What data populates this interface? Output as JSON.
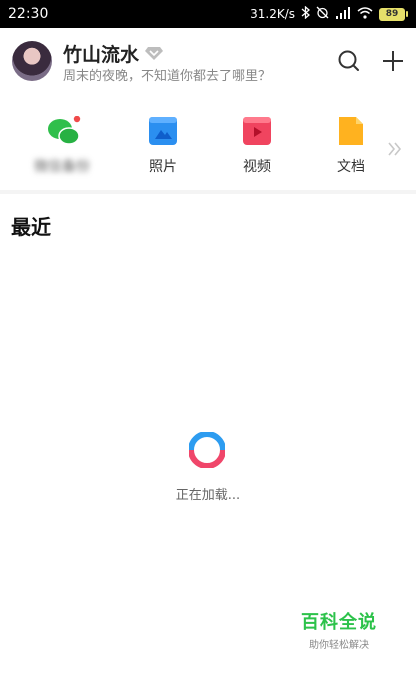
{
  "status_bar": {
    "time": "22:30",
    "network_speed": "31.2K/s",
    "battery": "89"
  },
  "header": {
    "username": "竹山流水",
    "motto": "周末的夜晚，不知道你都去了哪里？"
  },
  "shortcuts": [
    {
      "label": "微信备份",
      "icon": "wechat-icon",
      "color": "#2fbf4b"
    },
    {
      "label": "照片",
      "icon": "photo-icon",
      "color": "#2b8ff0"
    },
    {
      "label": "视频",
      "icon": "video-icon",
      "color": "#f0445f"
    },
    {
      "label": "文档",
      "icon": "document-icon",
      "color": "#ffb21f"
    }
  ],
  "recent": {
    "title": "最近",
    "loading_text": "正在加载..."
  },
  "watermark": {
    "title": "百科全说",
    "subtitle": "助你轻松解决"
  }
}
